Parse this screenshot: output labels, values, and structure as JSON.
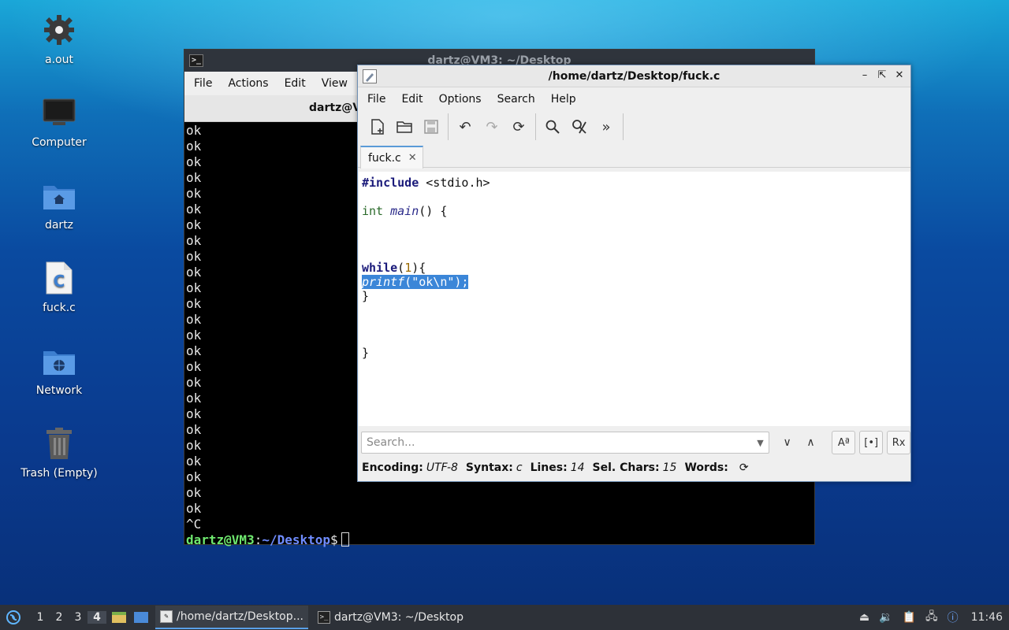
{
  "desktop": {
    "icons": [
      {
        "label": "a.out",
        "icon": "gear-icon"
      },
      {
        "label": "Computer",
        "icon": "monitor-icon"
      },
      {
        "label": "dartz",
        "icon": "home-folder-icon"
      },
      {
        "label": "fuck.c",
        "icon": "c-source-file-icon"
      },
      {
        "label": "Network",
        "icon": "network-folder-icon"
      },
      {
        "label": "Trash (Empty)",
        "icon": "trash-icon"
      }
    ]
  },
  "terminal": {
    "title": "dartz@VM3: ~/Desktop",
    "menu": [
      "File",
      "Actions",
      "Edit",
      "View"
    ],
    "tab_label": "dartz@V",
    "output_lines": [
      "ok",
      "ok",
      "ok",
      "ok",
      "ok",
      "ok",
      "ok",
      "ok",
      "ok",
      "ok",
      "ok",
      "ok",
      "ok",
      "ok",
      "ok",
      "ok",
      "ok",
      "ok",
      "ok",
      "ok",
      "ok",
      "ok",
      "ok",
      "ok",
      "ok",
      "^C"
    ],
    "prompt_user": "dartz@VM3",
    "prompt_sep": ":",
    "prompt_path": "~/Desktop",
    "prompt_char": "$"
  },
  "editor": {
    "title": "/home/dartz/Desktop/fuck.c",
    "menu": [
      "File",
      "Edit",
      "Options",
      "Search",
      "Help"
    ],
    "tab_label": "fuck.c",
    "code": {
      "include_kw": "#include",
      "include_rest": " <stdio.h>",
      "int_kw": "int",
      "main_fn": "main",
      "main_rest": "() {",
      "while_kw": "while",
      "while_open": "(",
      "while_num": "1",
      "while_close": "){",
      "printf_fn": "printf",
      "printf_rest": "(\"ok\\n\");",
      "brace_inner": "}",
      "brace_outer": "}"
    },
    "search_placeholder": "Search...",
    "status": {
      "encoding_label": "Encoding:",
      "encoding_value": "UTF-8",
      "syntax_label": "Syntax:",
      "syntax_value": "c",
      "lines_label": "Lines:",
      "lines_value": "14",
      "selchars_label": "Sel. Chars:",
      "selchars_value": "15",
      "words_label": "Words:"
    }
  },
  "taskbar": {
    "desktops": [
      "1",
      "2",
      "3",
      "4"
    ],
    "active_desktop": "4",
    "tasks": [
      {
        "label": "/home/dartz/Desktop..."
      },
      {
        "label": "dartz@VM3: ~/Desktop"
      }
    ],
    "clock": "11:46"
  }
}
